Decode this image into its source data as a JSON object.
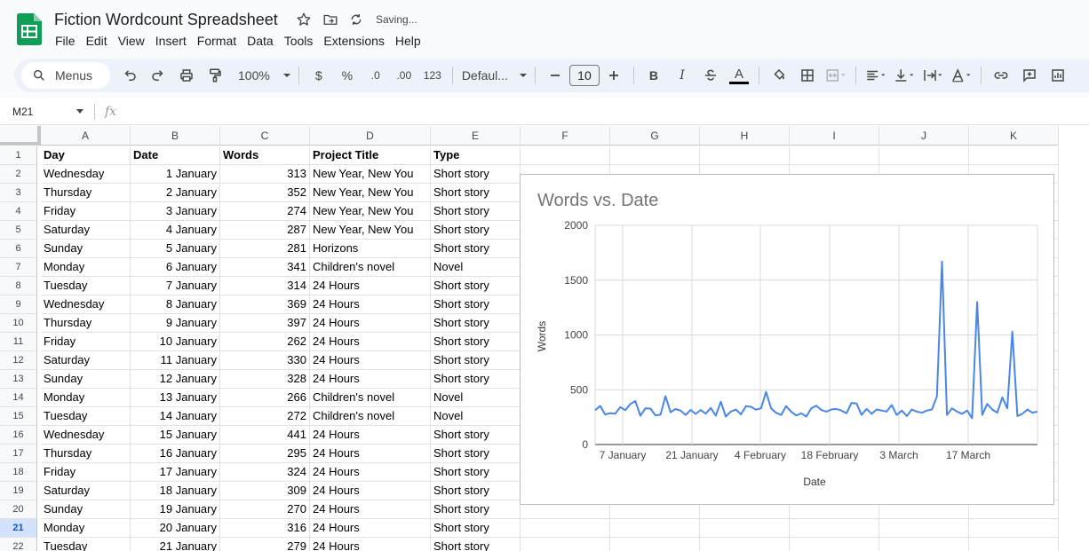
{
  "title": "Fiction Wordcount Spreadsheet",
  "saving": "Saving...",
  "menu": [
    "File",
    "Edit",
    "View",
    "Insert",
    "Format",
    "Data",
    "Tools",
    "Extensions",
    "Help"
  ],
  "toolbar": {
    "search": "Menus",
    "zoom": "100%",
    "currency": "$",
    "percent": "%",
    "dec_decrease": ".0",
    "dec_increase": ".00",
    "number_format": "123",
    "font": "Defaul...",
    "font_size": "10",
    "bold": "B",
    "italic": "I",
    "text_color": "A"
  },
  "name_box": "M21",
  "fx": "fx",
  "columns": [
    "A",
    "B",
    "C",
    "D",
    "E",
    "F",
    "G",
    "H",
    "I",
    "J",
    "K"
  ],
  "active_row": 21,
  "rows": [
    {
      "n": "1",
      "a": "Day",
      "b": "Date",
      "c": "Words",
      "d": "Project Title",
      "e": "Type"
    },
    {
      "n": "2",
      "a": "Wednesday",
      "b": "1 January",
      "c": "313",
      "d": "New Year, New You",
      "e": "Short story"
    },
    {
      "n": "3",
      "a": "Thursday",
      "b": "2 January",
      "c": "352",
      "d": "New Year, New You",
      "e": "Short story"
    },
    {
      "n": "4",
      "a": "Friday",
      "b": "3 January",
      "c": "274",
      "d": "New Year, New You",
      "e": "Short story"
    },
    {
      "n": "5",
      "a": "Saturday",
      "b": "4 January",
      "c": "287",
      "d": "New Year, New You",
      "e": "Short story"
    },
    {
      "n": "6",
      "a": "Sunday",
      "b": "5 January",
      "c": "281",
      "d": "Horizons",
      "e": "Short story"
    },
    {
      "n": "7",
      "a": "Monday",
      "b": "6 January",
      "c": "341",
      "d": "Children's novel",
      "e": "Novel"
    },
    {
      "n": "8",
      "a": "Tuesday",
      "b": "7 January",
      "c": "314",
      "d": "24 Hours",
      "e": "Short story"
    },
    {
      "n": "9",
      "a": "Wednesday",
      "b": "8 January",
      "c": "369",
      "d": "24 Hours",
      "e": "Short story"
    },
    {
      "n": "10",
      "a": "Thursday",
      "b": "9 January",
      "c": "397",
      "d": "24 Hours",
      "e": "Short story"
    },
    {
      "n": "11",
      "a": "Friday",
      "b": "10 January",
      "c": "262",
      "d": "24 Hours",
      "e": "Short story"
    },
    {
      "n": "12",
      "a": "Saturday",
      "b": "11 January",
      "c": "330",
      "d": "24 Hours",
      "e": "Short story"
    },
    {
      "n": "13",
      "a": "Sunday",
      "b": "12 January",
      "c": "328",
      "d": "24 Hours",
      "e": "Short story"
    },
    {
      "n": "14",
      "a": "Monday",
      "b": "13 January",
      "c": "266",
      "d": "Children's novel",
      "e": "Novel"
    },
    {
      "n": "15",
      "a": "Tuesday",
      "b": "14 January",
      "c": "272",
      "d": "Children's novel",
      "e": "Novel"
    },
    {
      "n": "16",
      "a": "Wednesday",
      "b": "15 January",
      "c": "441",
      "d": "24 Hours",
      "e": "Short story"
    },
    {
      "n": "17",
      "a": "Thursday",
      "b": "16 January",
      "c": "295",
      "d": "24 Hours",
      "e": "Short story"
    },
    {
      "n": "18",
      "a": "Friday",
      "b": "17 January",
      "c": "324",
      "d": "24 Hours",
      "e": "Short story"
    },
    {
      "n": "19",
      "a": "Saturday",
      "b": "18 January",
      "c": "309",
      "d": "24 Hours",
      "e": "Short story"
    },
    {
      "n": "20",
      "a": "Sunday",
      "b": "19 January",
      "c": "270",
      "d": "24 Hours",
      "e": "Short story"
    },
    {
      "n": "21",
      "a": "Monday",
      "b": "20 January",
      "c": "316",
      "d": "24 Hours",
      "e": "Short story"
    },
    {
      "n": "22",
      "a": "Tuesday",
      "b": "21 January",
      "c": "279",
      "d": "24 Hours",
      "e": "Short story"
    }
  ],
  "chart_data": {
    "type": "line",
    "title": "Words vs. Date",
    "xlabel": "Date",
    "ylabel": "Words",
    "ylim": [
      0,
      2000
    ],
    "yticks": [
      "0",
      "500",
      "1000",
      "1500",
      "2000"
    ],
    "xticks": [
      "7 January",
      "21 January",
      "4 February",
      "18 February",
      "3 March",
      "17 March"
    ],
    "grid": true,
    "color": "#4a86e8",
    "x_start": "1 January",
    "x_end": "31 March",
    "series": [
      {
        "values": [
          313,
          352,
          274,
          287,
          281,
          341,
          314,
          369,
          397,
          262,
          330,
          328,
          266,
          272,
          441,
          295,
          324,
          309,
          270,
          316,
          279,
          315,
          282,
          334,
          263,
          390,
          255,
          301,
          320,
          275,
          350,
          344,
          318,
          330,
          480,
          330,
          290,
          270,
          350,
          300,
          265,
          285,
          255,
          330,
          355,
          315,
          300,
          320,
          325,
          310,
          285,
          380,
          375,
          270,
          325,
          280,
          320,
          310,
          300,
          360,
          270,
          310,
          260,
          320,
          300,
          290,
          310,
          320,
          440,
          1670,
          270,
          330,
          300,
          280,
          310,
          240,
          1300,
          270,
          370,
          320,
          290,
          430,
          330,
          1030,
          260,
          280,
          320,
          290,
          300
        ]
      }
    ]
  }
}
